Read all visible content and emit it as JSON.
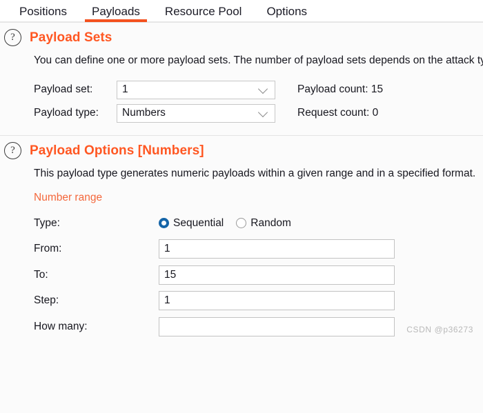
{
  "tabs": [
    {
      "label": "Positions",
      "active": false
    },
    {
      "label": "Payloads",
      "active": true
    },
    {
      "label": "Resource Pool",
      "active": false
    },
    {
      "label": "Options",
      "active": false
    }
  ],
  "colors": {
    "accent_orange": "#ff5722",
    "tab_underline": "#f4511e",
    "subheading_orange": "#f4673b",
    "radio_selected": "#1565a8",
    "background": "#fbfbfb"
  },
  "payload_sets": {
    "help_icon": "question-circle-icon",
    "title": "Payload Sets",
    "description": "You can define one or more payload sets. The number of payload sets depends on the attack type defined in the Positions tab. Various payload types are available for each payload set, and each payload type can be customized in different ways.",
    "payload_set": {
      "label": "Payload set:",
      "value": "1",
      "options": [
        "1"
      ]
    },
    "payload_type": {
      "label": "Payload type:",
      "value": "Numbers",
      "options": [
        "Numbers"
      ]
    },
    "payload_count": "Payload count: 15",
    "request_count": "Request count: 0"
  },
  "payload_options": {
    "help_icon": "question-circle-icon",
    "title": "Payload Options [Numbers]",
    "description": "This payload type generates numeric payloads within a given range and in a specified format.",
    "subheading": "Number range",
    "type_row": {
      "label": "Type:",
      "choices": [
        {
          "label": "Sequential",
          "selected": true
        },
        {
          "label": "Random",
          "selected": false
        }
      ]
    },
    "fields": [
      {
        "label": "From:",
        "value": "1",
        "placeholder": ""
      },
      {
        "label": "To:",
        "value": "15",
        "placeholder": ""
      },
      {
        "label": "Step:",
        "value": "1",
        "placeholder": ""
      },
      {
        "label": "How many:",
        "value": "",
        "placeholder": ""
      }
    ]
  },
  "watermark": "CSDN @p36273"
}
